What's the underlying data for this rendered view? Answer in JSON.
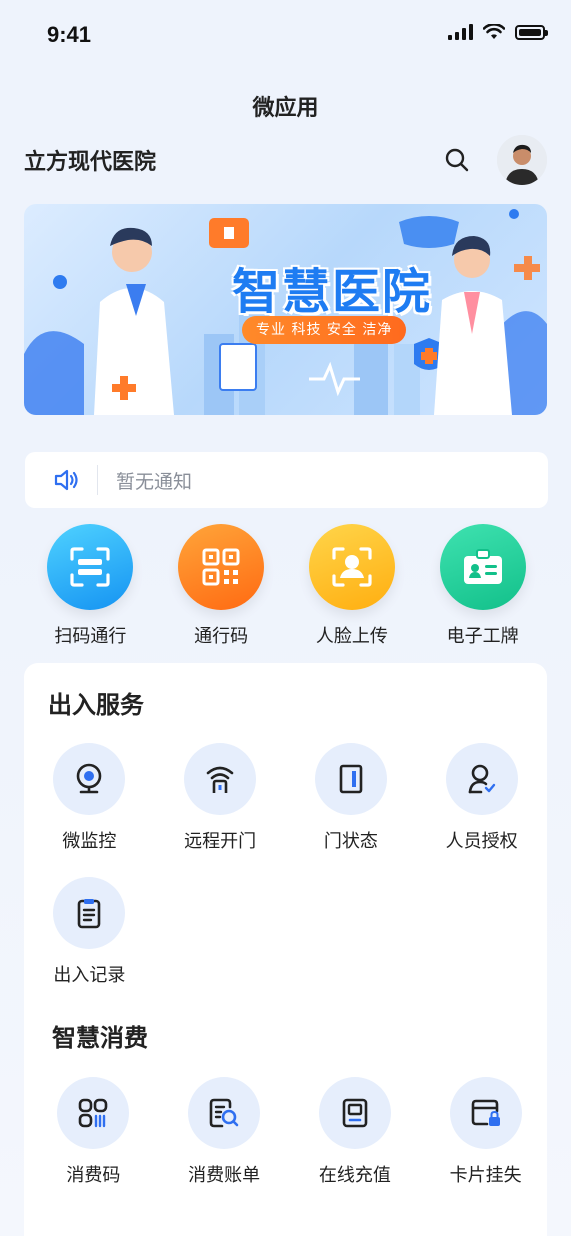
{
  "status_bar": {
    "time": "9:41"
  },
  "page_title": "微应用",
  "header": {
    "hospital_name": "立方现代医院"
  },
  "banner": {
    "title": "智慧医院",
    "subtitle": "专业 科技 安全 洁净"
  },
  "notice": {
    "text": "暂无通知"
  },
  "quick_actions": [
    {
      "label": "扫码通行",
      "icon": "scan-icon",
      "color": "#1aa8f5"
    },
    {
      "label": "通行码",
      "icon": "qr-code-icon",
      "color": "#ff8a1e"
    },
    {
      "label": "人脸上传",
      "icon": "face-upload-icon",
      "color": "#ffbf1f"
    },
    {
      "label": "电子工牌",
      "icon": "badge-icon",
      "color": "#22cf9a"
    }
  ],
  "sections": {
    "access": {
      "title": "出入服务",
      "items": [
        {
          "label": "微监控",
          "icon": "camera-icon"
        },
        {
          "label": "远程开门",
          "icon": "remote-door-icon"
        },
        {
          "label": "门状态",
          "icon": "door-status-icon"
        },
        {
          "label": "人员授权",
          "icon": "user-auth-icon"
        },
        {
          "label": "出入记录",
          "icon": "record-icon"
        }
      ]
    },
    "consumption": {
      "title": "智慧消费",
      "items": [
        {
          "label": "消费码",
          "icon": "pay-code-icon"
        },
        {
          "label": "消费账单",
          "icon": "bill-icon"
        },
        {
          "label": "在线充值",
          "icon": "recharge-icon"
        },
        {
          "label": "卡片挂失",
          "icon": "card-lock-icon"
        }
      ]
    }
  },
  "colors": {
    "accent": "#2f6ff0",
    "icon_bg": "#e6eefc"
  }
}
